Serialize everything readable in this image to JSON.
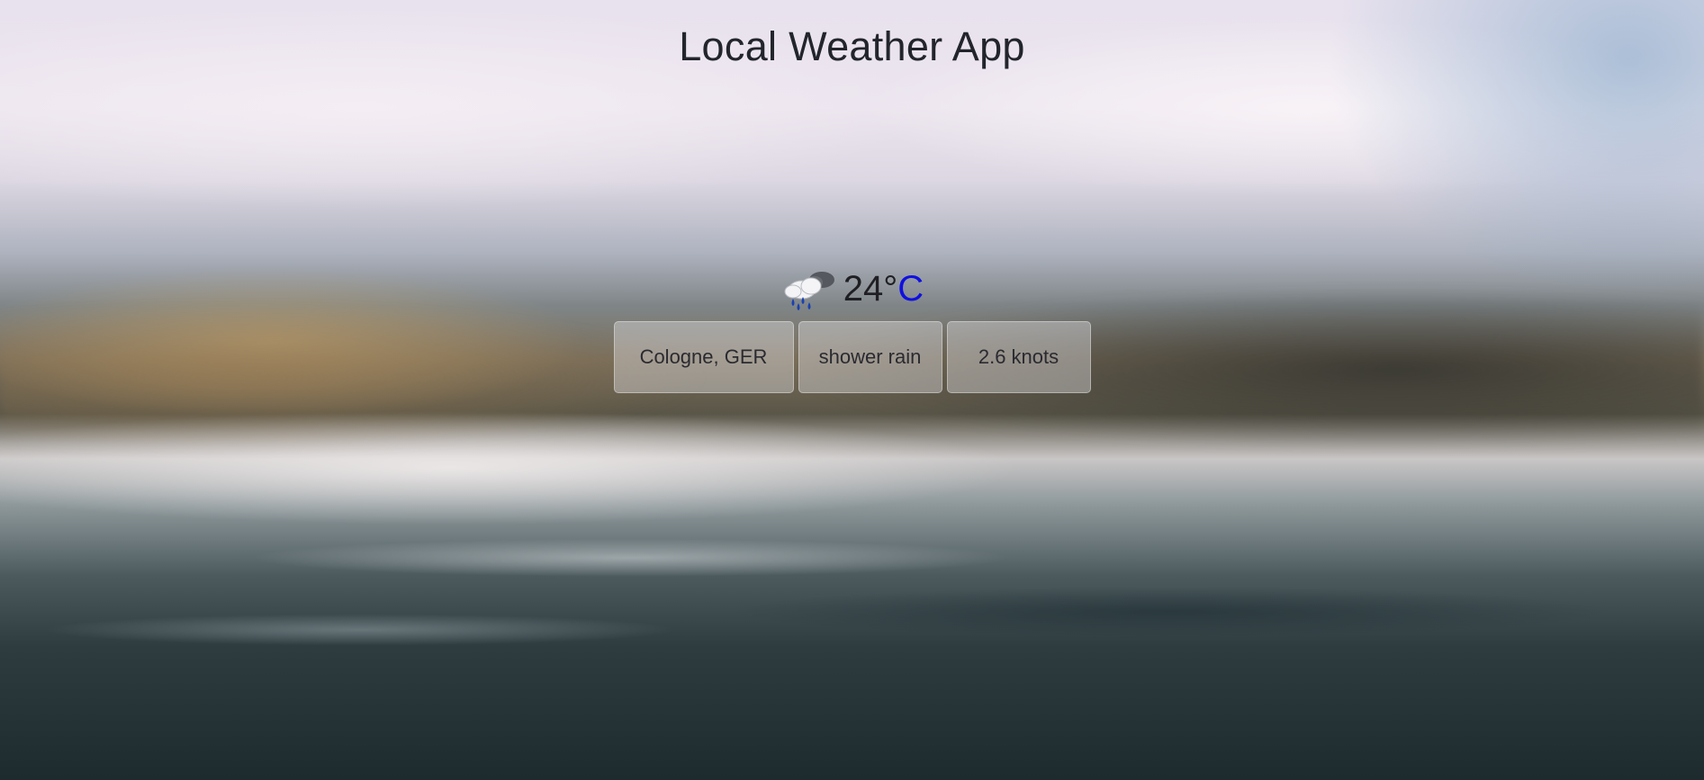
{
  "app": {
    "title": "Local Weather App"
  },
  "current": {
    "icon": "shower-rain-cloud-icon",
    "temperature": "24°",
    "unit": "C",
    "unit_color": "#1010e0"
  },
  "details": {
    "location": "Cologne, GER",
    "description": "shower rain",
    "wind": "2.6 knots"
  }
}
